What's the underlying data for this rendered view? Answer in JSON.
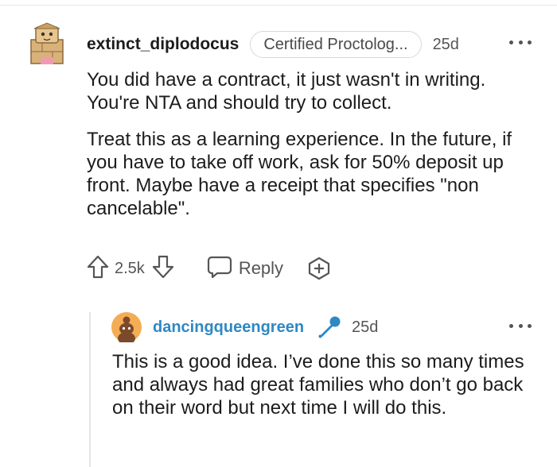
{
  "comment": {
    "username": "extinct_diplodocus",
    "flair": "Certified Proctolog...",
    "age": "25d",
    "paragraphs": [
      "You did have a contract, it just wasn't in writing. You're NTA and should try to collect.",
      "Treat this as a learning experience. In the future, if you have to take off work, ask for 50% deposit up front. Maybe have a receipt that specifies \"non cancelable\"."
    ],
    "score": "2.5k",
    "reply_label": "Reply",
    "avatar_icon": "snoo-avatar-icon",
    "icons": [
      "upvote-icon",
      "downvote-icon",
      "reply-icon",
      "award-icon",
      "more-options-icon"
    ]
  },
  "reply": {
    "username": "dancingqueengreen",
    "age": "25d",
    "text": "This is a good idea. I’ve done this so many times and always had great families who don’t go back on their word but next time I will do this.",
    "avatar_icon": "snoo-avatar-icon",
    "badge_icon": "microphone-icon"
  },
  "colors": {
    "username_reply": "#2e88c4",
    "mic": "#2e88c4",
    "avatar_bg": "#f4ad54",
    "secondary_text": "#555555"
  }
}
